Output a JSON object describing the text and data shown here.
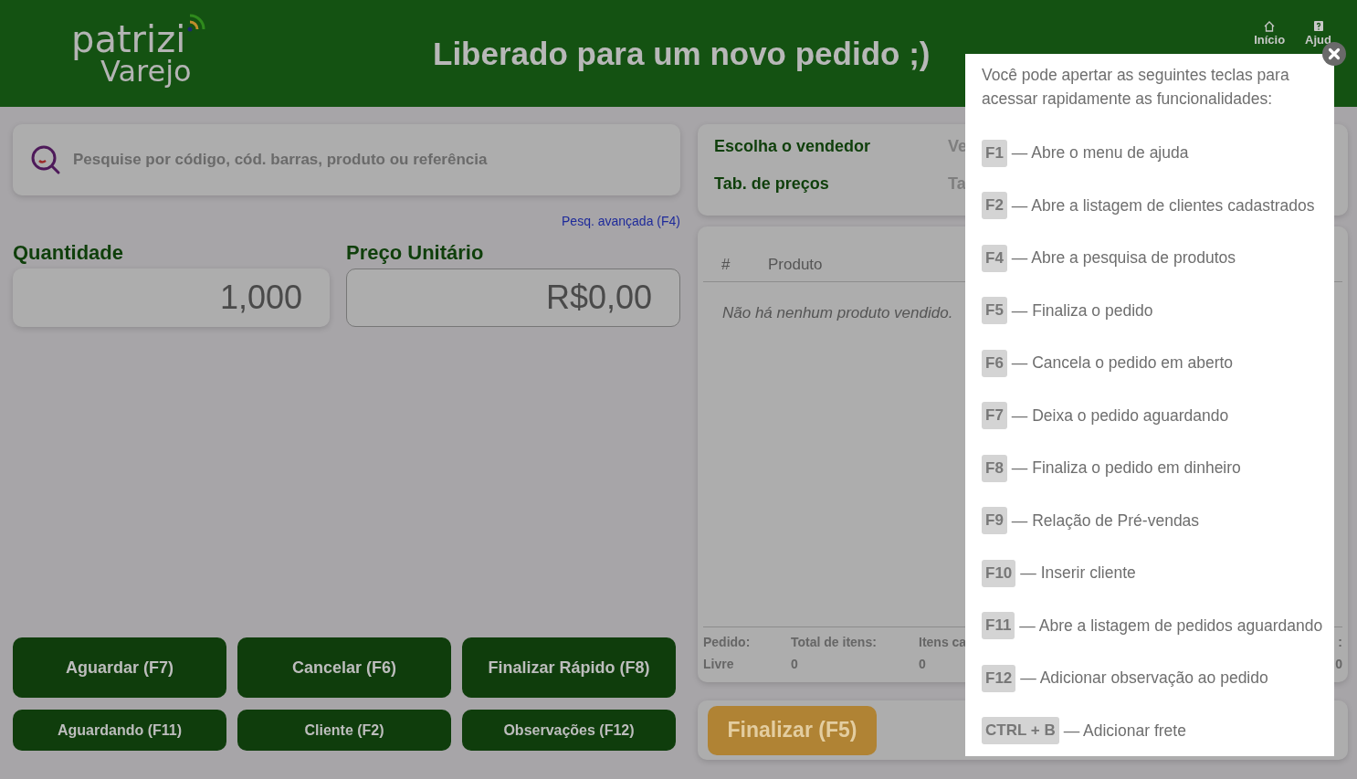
{
  "header": {
    "logo_top": "patrizi",
    "logo_bottom": "Varejo",
    "title": "Liberado para um novo pedido ;)",
    "nav": [
      {
        "label": "Início",
        "kind": "home"
      },
      {
        "label": "Ajud",
        "kind": "help"
      }
    ]
  },
  "search": {
    "placeholder": "Pesquise por código, cód. barras, produto ou referência",
    "advanced_link": "Pesq. avançada (F4)"
  },
  "quantity": {
    "label": "Quantidade",
    "value": "1,000"
  },
  "unit_price": {
    "label": "Preço Unitário",
    "value": "R$0,00"
  },
  "actions": [
    {
      "label": "Aguardar (F7)",
      "kind": "large"
    },
    {
      "label": "Cancelar (F6)",
      "kind": "large"
    },
    {
      "label": "Finalizar Rápido (F8)",
      "kind": "large"
    },
    {
      "label": "Aguardando (F11)",
      "kind": "small"
    },
    {
      "label": "Cliente (F2)",
      "kind": "small"
    },
    {
      "label": "Observações (F12)",
      "kind": "small"
    }
  ],
  "order_settings": [
    {
      "label": "Escolha o vendedor",
      "value": "Ve"
    },
    {
      "label": "Tab. de preços",
      "value": "Ta"
    }
  ],
  "table": {
    "columns": [
      "#",
      "Produto"
    ],
    "empty_message": "Não há nenhum produto vendido."
  },
  "summary": [
    {
      "label": "Pedido:",
      "value": "Livre"
    },
    {
      "label": "Total de itens:",
      "value": "0"
    },
    {
      "label": "Itens ca",
      "value": "0"
    },
    {
      "label": ":",
      "value": "0"
    }
  ],
  "finish_button": "Finalizar (F5)",
  "help_popup": {
    "intro": "Você pode apertar as seguintes teclas para acessar rapidamente as funcionalidades:",
    "shortcuts": [
      {
        "key": "F1",
        "description": "— Abre o menu de ajuda"
      },
      {
        "key": "F2",
        "description": "— Abre a listagem de clientes cadastrados"
      },
      {
        "key": "F4",
        "description": "— Abre a pesquisa de produtos"
      },
      {
        "key": "F5",
        "description": "— Finaliza o pedido"
      },
      {
        "key": "F6",
        "description": "— Cancela o pedido em aberto"
      },
      {
        "key": "F7",
        "description": "— Deixa o pedido aguardando"
      },
      {
        "key": "F8",
        "description": "— Finaliza o pedido em dinheiro"
      },
      {
        "key": "F9",
        "description": "— Relação de Pré-vendas"
      },
      {
        "key": "F10",
        "description": "— Inserir cliente"
      },
      {
        "key": "F11",
        "description": "— Abre a listagem de pedidos aguardando"
      },
      {
        "key": "F12",
        "description": "— Adicionar observação ao pedido"
      },
      {
        "key": "CTRL + B",
        "description": "— Adicionar frete"
      }
    ]
  }
}
